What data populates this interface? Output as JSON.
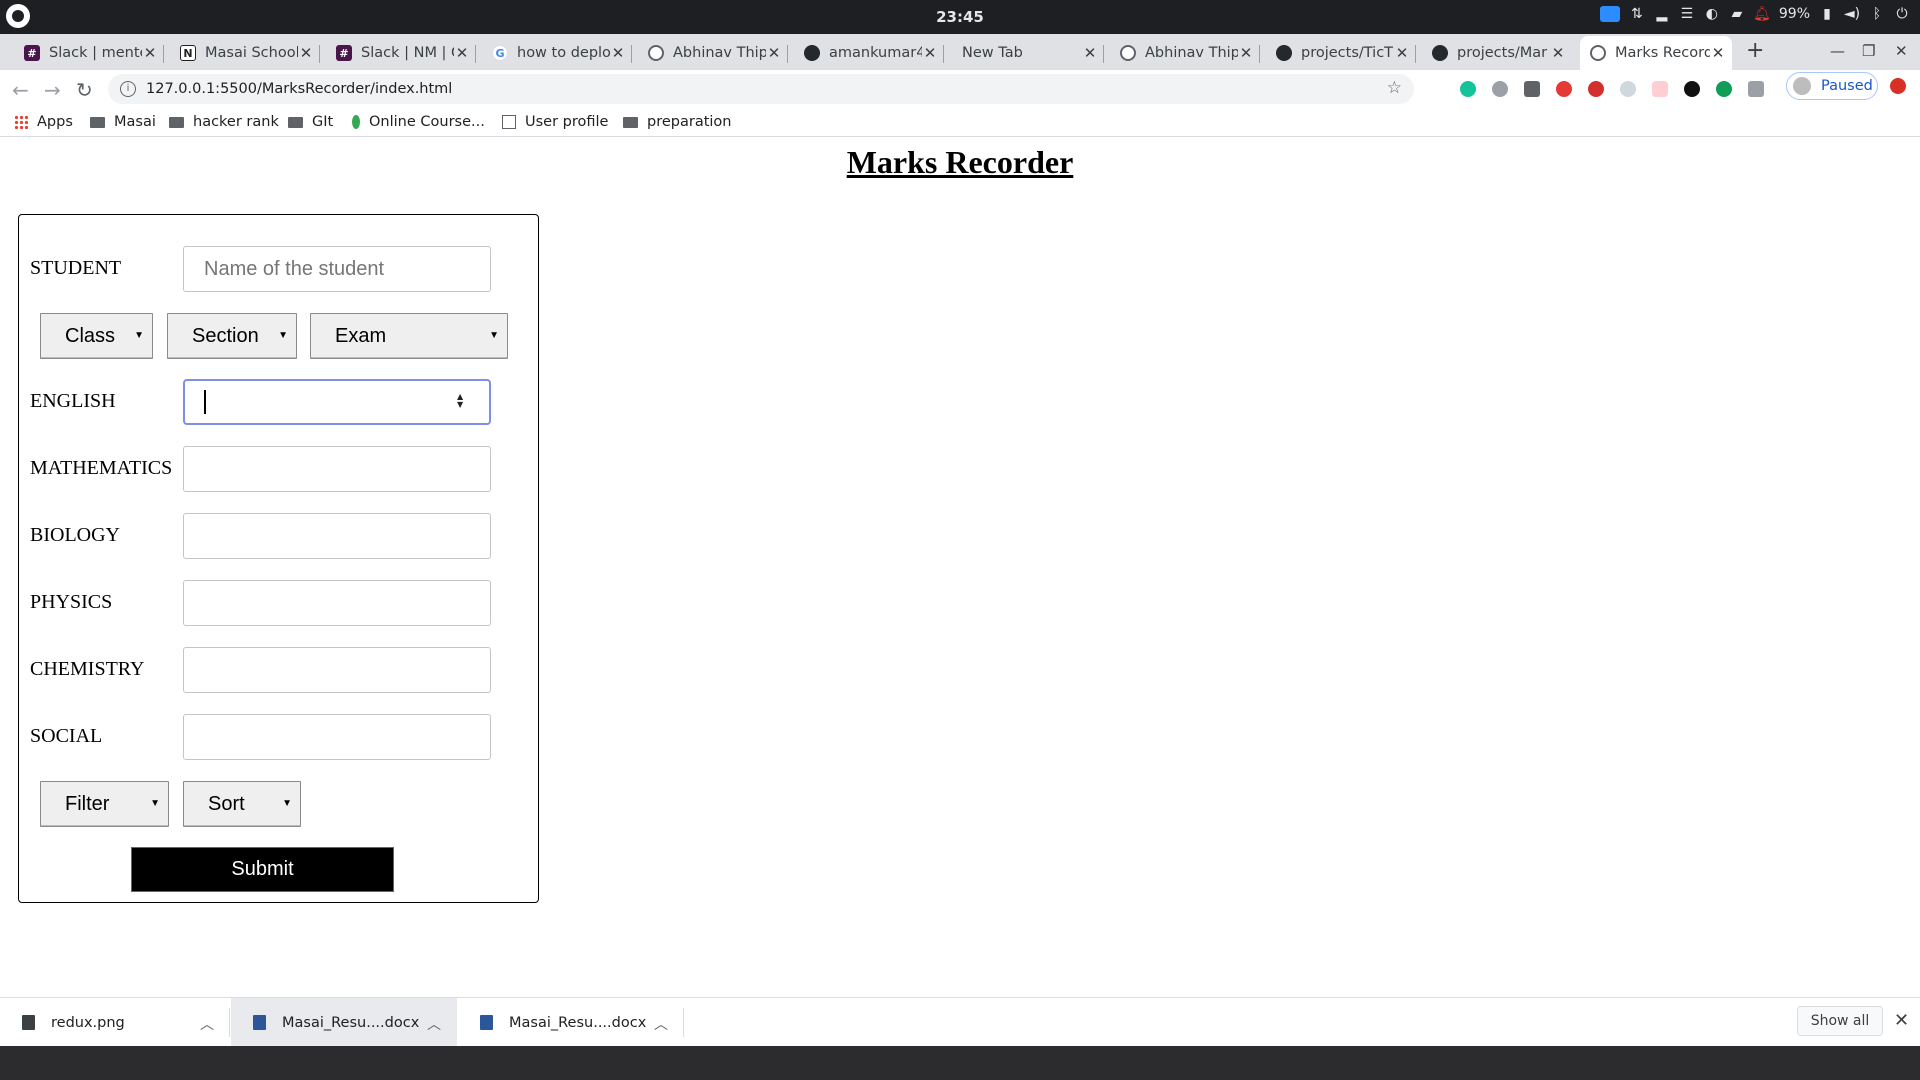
{
  "os": {
    "clock": "23:45",
    "battery": "99%"
  },
  "tabs": [
    {
      "label": "Slack | mente",
      "icon": "slack-icon"
    },
    {
      "label": "Masai School",
      "icon": "notion-icon"
    },
    {
      "label": "Slack | NM | C",
      "icon": "slack-icon"
    },
    {
      "label": "how to deplo",
      "icon": "google-icon"
    },
    {
      "label": "Abhinav Thip",
      "icon": "globe-icon"
    },
    {
      "label": "amankumar4",
      "icon": "github-icon"
    },
    {
      "label": "New Tab",
      "icon": ""
    },
    {
      "label": "Abhinav Thip",
      "icon": "globe-icon"
    },
    {
      "label": "projects/TicT",
      "icon": "github-icon"
    },
    {
      "label": "projects/Mar",
      "icon": "github-icon"
    },
    {
      "label": "Marks Record",
      "icon": "globe-icon",
      "active": true
    }
  ],
  "address_bar": {
    "url": "127.0.0.1:5500/MarksRecorder/index.html",
    "profile_label": "Paused"
  },
  "bookmarks": [
    {
      "label": "Apps",
      "icon": "apps-grid-icon"
    },
    {
      "label": "Masai",
      "icon": "folder-icon"
    },
    {
      "label": "hacker rank",
      "icon": "folder-icon"
    },
    {
      "label": "GIt",
      "icon": "folder-icon"
    },
    {
      "label": "Online Course...",
      "icon": "leaf-icon"
    },
    {
      "label": "User profile",
      "icon": "page-icon"
    },
    {
      "label": "preparation",
      "icon": "folder-icon"
    }
  ],
  "page": {
    "title": "Marks Recorder",
    "student_label": "STUDENT",
    "student_placeholder": "Name of the student",
    "selects": {
      "class": "Class",
      "section": "Section",
      "exam": "Exam",
      "filter": "Filter",
      "sort": "Sort"
    },
    "subjects": [
      "ENGLISH",
      "MATHEMATICS",
      "BIOLOGY",
      "PHYSICS",
      "CHEMISTRY",
      "SOCIAL"
    ],
    "submit_label": "Submit"
  },
  "downloads": {
    "items": [
      {
        "name": "redux.png",
        "type": "image"
      },
      {
        "name": "Masai_Resu....docx",
        "type": "word"
      },
      {
        "name": "Masai_Resu....docx",
        "type": "word"
      }
    ],
    "show_all": "Show all"
  },
  "colors": {
    "accent_focus": "#7d8fe6",
    "submit_bg": "#000000",
    "profile_paused": "#1a56c8"
  }
}
